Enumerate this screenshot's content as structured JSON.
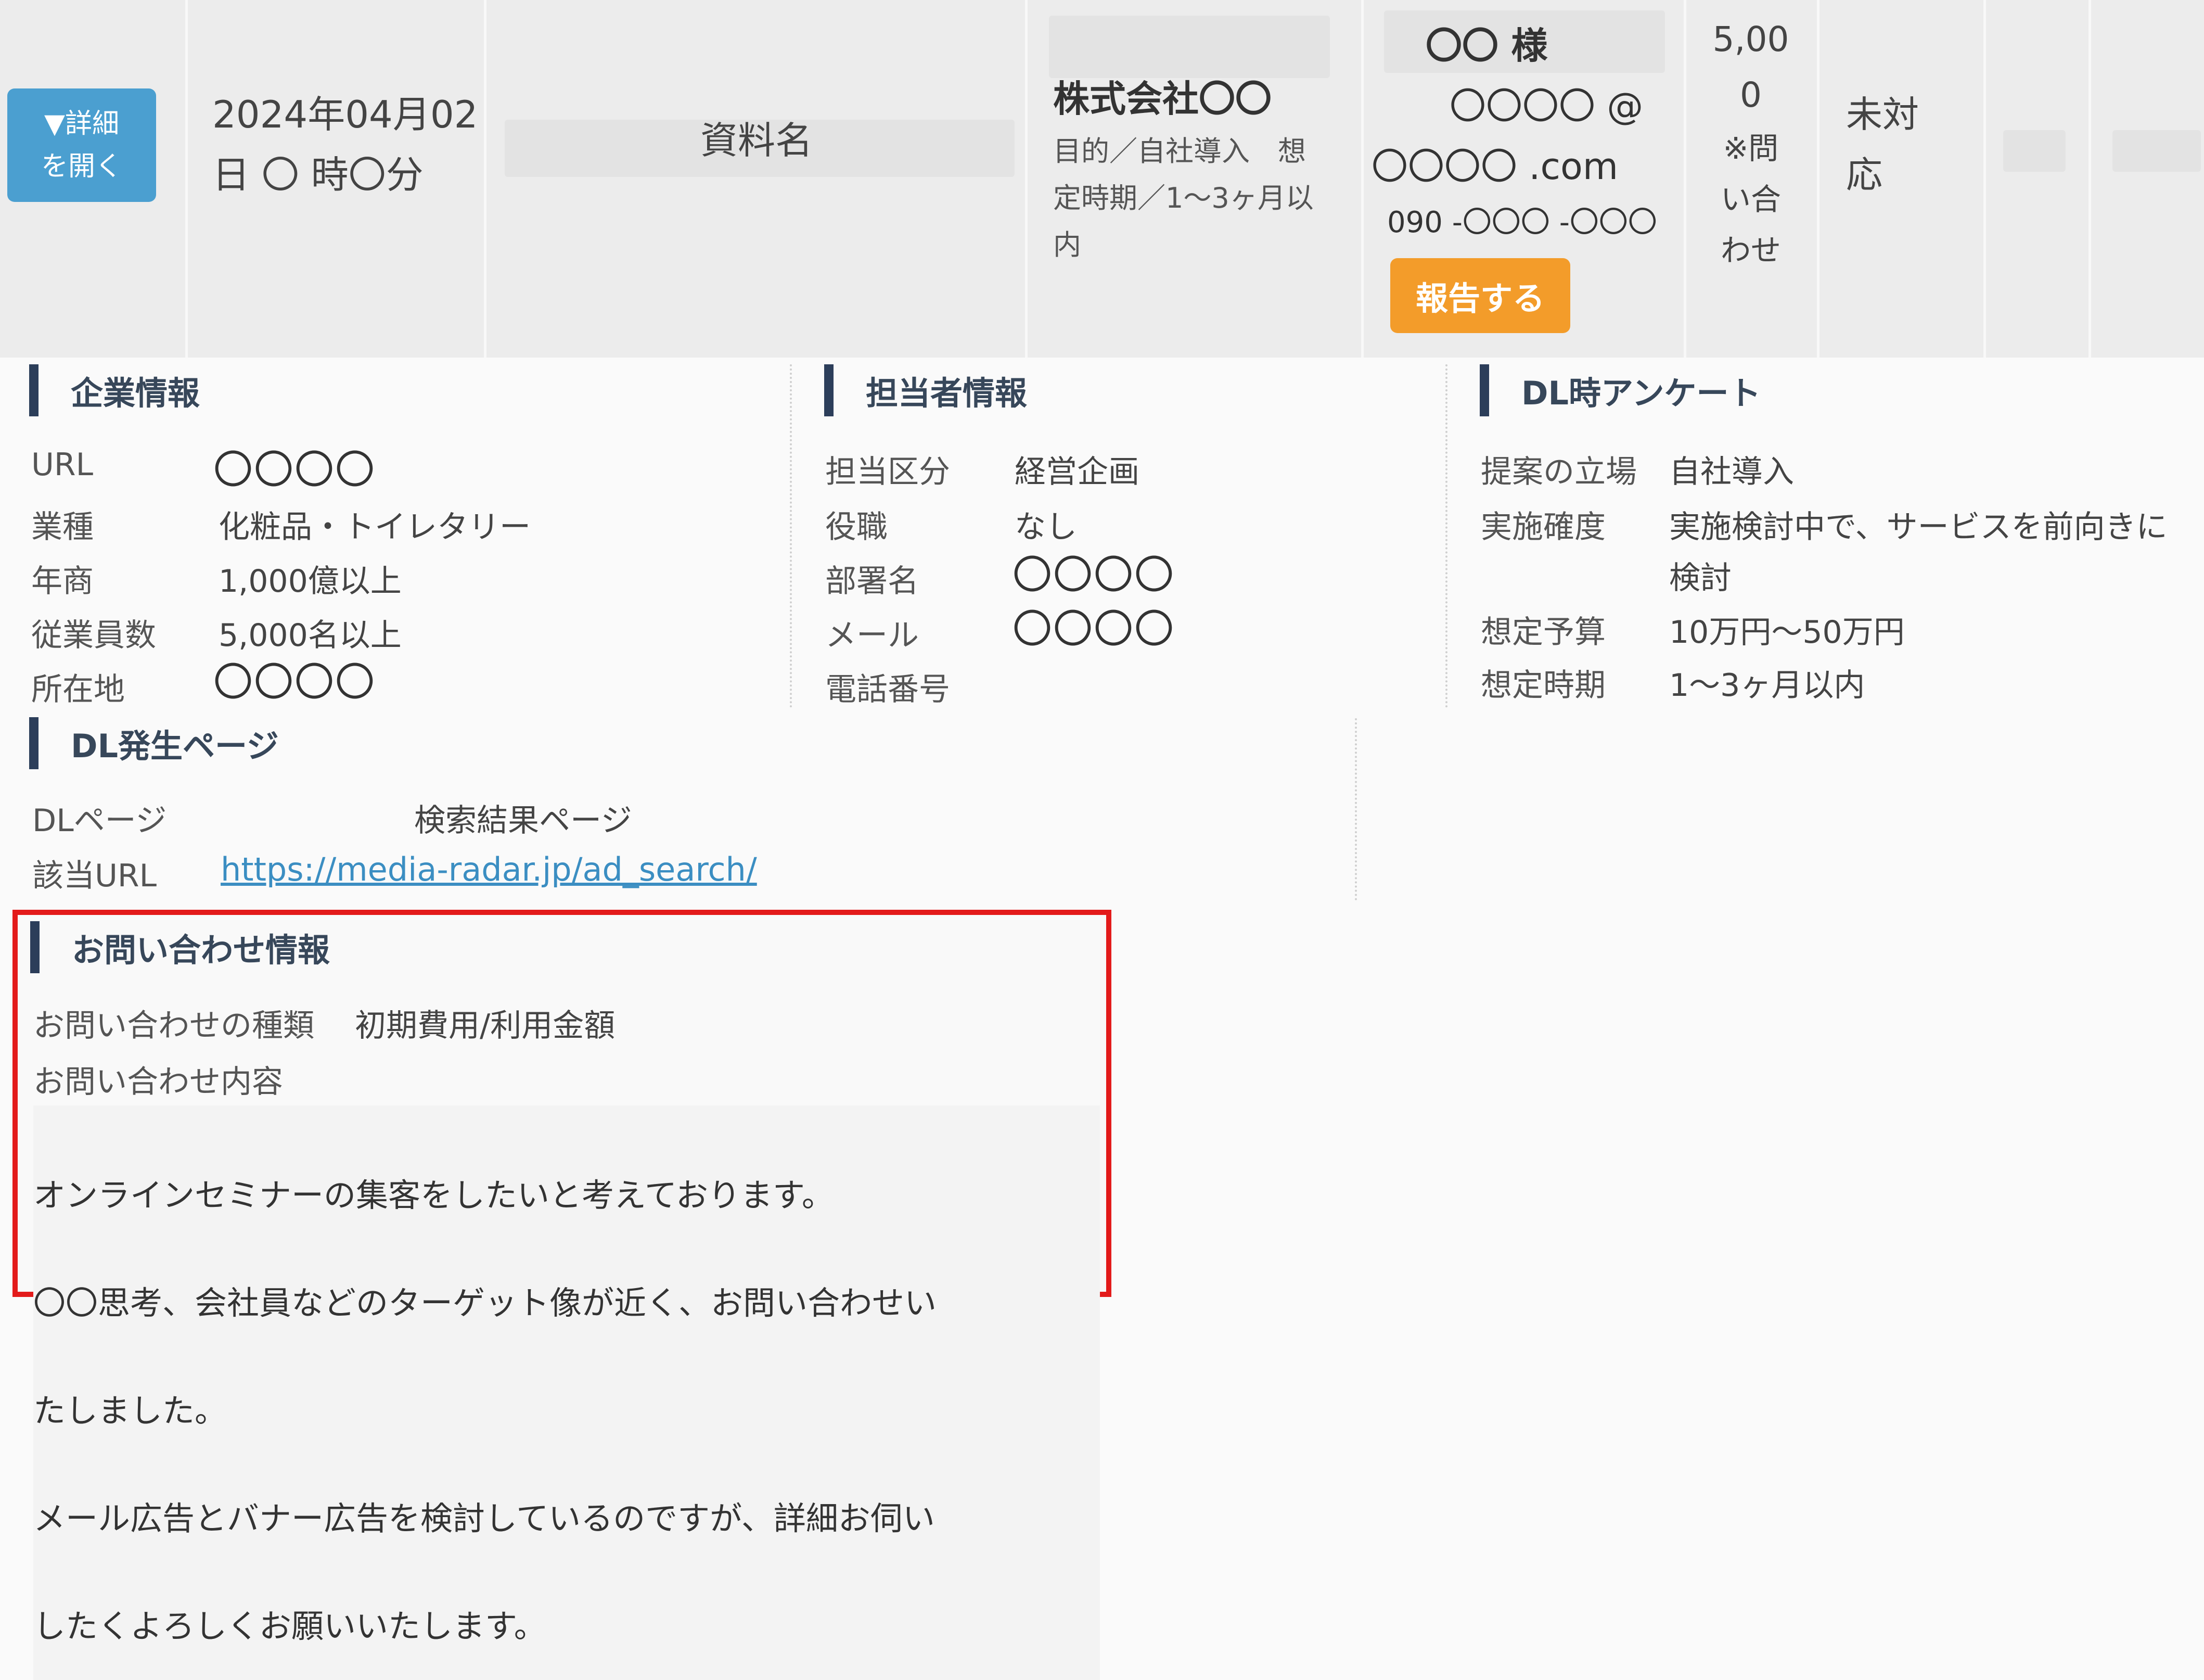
{
  "row": {
    "detail_button": {
      "line1": "▼詳細",
      "line2": "を開く"
    },
    "datetime": {
      "line1": "2024年04月02",
      "line2": "日 〇 時〇分"
    },
    "material_name": "資料名",
    "company": {
      "name": "株式会社〇〇",
      "note_line1": "目的／自社導入　想",
      "note_line2": "定時期／1〜3ヶ月以",
      "note_line3": "内"
    },
    "contact": {
      "name": "〇〇 様",
      "email_line1": "〇〇〇〇 @",
      "email_line2": "〇〇〇〇 .com",
      "phone": "090 -〇〇〇 -〇〇〇",
      "report_button": "報告する"
    },
    "amount": {
      "line1": "5,00",
      "line2": "0",
      "line3": "※問",
      "line4": "い合",
      "line5": "わせ"
    },
    "status": {
      "line1": "未対",
      "line2": "応"
    }
  },
  "company_info": {
    "title": "企業情報",
    "url_label": "URL",
    "url_value": "〇〇〇〇",
    "industry_label": "業種",
    "industry_value": "化粧品・トイレタリー",
    "revenue_label": "年商",
    "revenue_value": "1,000億以上",
    "employees_label": "従業員数",
    "employees_value": "5,000名以上",
    "location_label": "所在地",
    "location_value": "〇〇〇〇"
  },
  "person_info": {
    "title": "担当者情報",
    "division_label": "担当区分",
    "division_value": "経営企画",
    "position_label": "役職",
    "position_value": "なし",
    "department_label": "部署名",
    "department_value": "〇〇〇〇",
    "mail_label": "メール",
    "mail_value": "〇〇〇〇",
    "phone_label": "電話番号"
  },
  "survey": {
    "title": "DL時アンケート",
    "stance_label": "提案の立場",
    "stance_value": "自社導入",
    "certainty_label": "実施確度",
    "certainty_value_line1": "実施検討中で、サービスを前向きに",
    "certainty_value_line2": "検討",
    "budget_label": "想定予算",
    "budget_value": "10万円〜50万円",
    "timing_label": "想定時期",
    "timing_value": "1〜3ヶ月以内"
  },
  "dl_page": {
    "title": "DL発生ページ",
    "page_label": "DLページ",
    "page_value": "検索結果ページ",
    "url_label": "該当URL",
    "url_value": "https://media-radar.jp/ad_search/"
  },
  "inquiry": {
    "title": "お問い合わせ情報",
    "type_label": "お問い合わせの種類",
    "type_value": "初期費用/利用金額",
    "content_label": "お問い合わせ内容",
    "content_lines": [
      "オンラインセミナーの集客をしたいと考えております。",
      "〇〇思考、会社員などのターゲット像が近く、お問い合わせい",
      "たしました。",
      "メール広告とバナー広告を検討しているのですが、詳細お伺い",
      "したくよろしくお願いいたします。"
    ]
  }
}
